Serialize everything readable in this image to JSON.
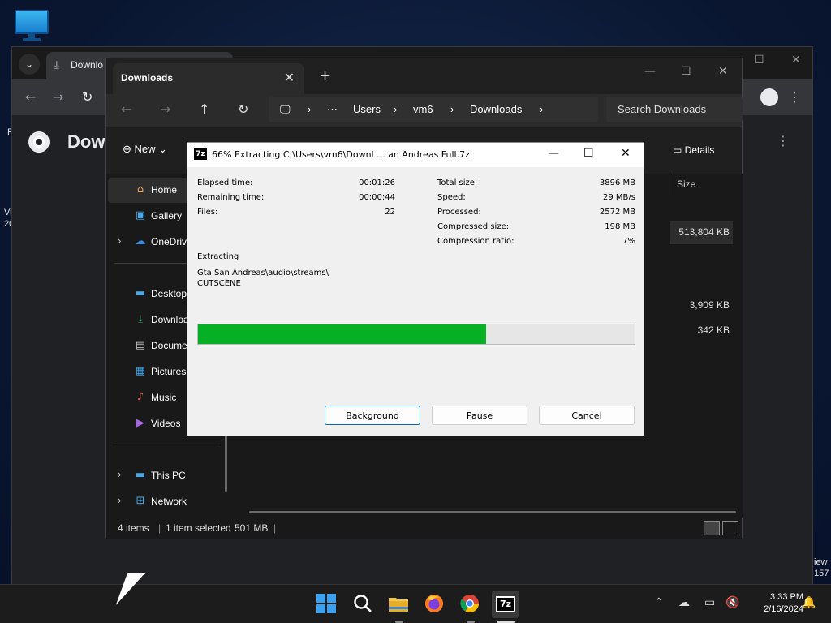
{
  "desktop": {
    "edge_left": [
      "R",
      "Vi",
      "20"
    ],
    "edge_right": [
      "iew",
      "157"
    ]
  },
  "chrome": {
    "tab_title": "Downlo",
    "page_title": "Dow"
  },
  "explorer": {
    "tab_title": "Downloads",
    "breadcrumb": [
      "Users",
      "vm6",
      "Downloads"
    ],
    "search_placeholder": "Search Downloads",
    "new_label": "New",
    "details_label": "Details",
    "size_header": "Size",
    "sidebar": [
      {
        "label": "Home",
        "icon": "home-icon",
        "selected": true
      },
      {
        "label": "Gallery",
        "icon": "gallery-icon"
      },
      {
        "label": "OneDriv",
        "icon": "cloud-icon"
      },
      {
        "label": "Desktop",
        "icon": "desktop-icon"
      },
      {
        "label": "Downloa",
        "icon": "download-icon"
      },
      {
        "label": "Docume",
        "icon": "document-icon"
      },
      {
        "label": "Pictures",
        "icon": "pictures-icon"
      },
      {
        "label": "Music",
        "icon": "music-icon"
      },
      {
        "label": "Videos",
        "icon": "videos-icon"
      },
      {
        "label": "This PC",
        "icon": "pc-icon"
      },
      {
        "label": "Network",
        "icon": "network-icon"
      }
    ],
    "sizes": [
      "513,804 KB",
      "3,909 KB",
      "342 KB"
    ],
    "status": {
      "items": "4 items",
      "selected": "1 item selected",
      "selected_size": "501 MB"
    }
  },
  "zip": {
    "title": "66% Extracting C:\\Users\\vm6\\Downl ... an Andreas Full.7z",
    "logo_text": "7z",
    "left": {
      "elapsed_label": "Elapsed time:",
      "elapsed_value": "00:01:26",
      "remaining_label": "Remaining time:",
      "remaining_value": "00:00:44",
      "files_label": "Files:",
      "files_value": "22"
    },
    "right": {
      "total_label": "Total size:",
      "total_value": "3896 MB",
      "speed_label": "Speed:",
      "speed_value": "29 MB/s",
      "processed_label": "Processed:",
      "processed_value": "2572 MB",
      "compressed_label": "Compressed size:",
      "compressed_value": "198 MB",
      "ratio_label": "Compression ratio:",
      "ratio_value": "7%"
    },
    "action": "Extracting",
    "path_line1": "Gta San Andreas\\audio\\streams\\",
    "path_line2": "CUTSCENE",
    "progress": 0.66,
    "buttons": {
      "background": "Background",
      "pause": "Pause",
      "cancel": "Cancel"
    },
    "progress_color": "#06b025"
  },
  "taskbar": {
    "time": "3:33 PM",
    "date": "2/16/2024",
    "icons": [
      "windows-start-icon",
      "search-icon",
      "file-explorer-icon",
      "firefox-icon",
      "chrome-icon",
      "7zip-icon"
    ]
  }
}
